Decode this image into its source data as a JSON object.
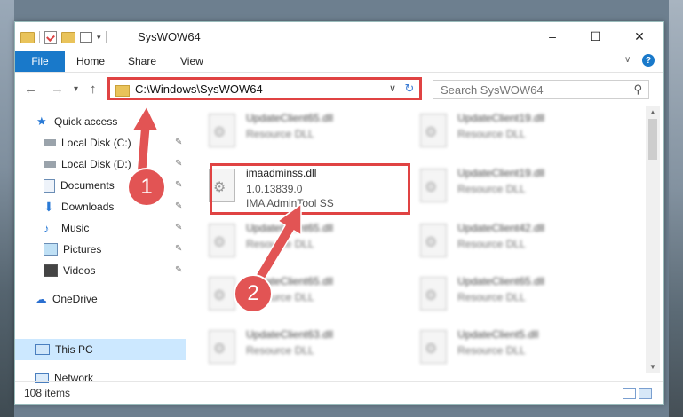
{
  "window": {
    "title": "SysWOW64",
    "controls": [
      "–",
      "☐",
      "✕"
    ]
  },
  "ribbon": {
    "tabs": [
      "File",
      "Home",
      "Share",
      "View"
    ],
    "help": "?"
  },
  "address": {
    "path": "C:\\Windows\\SysWOW64",
    "search_placeholder": "Search SysWOW64"
  },
  "sidebar": {
    "items": [
      {
        "label": "Quick access",
        "icon": "star-icon",
        "pinned": false
      },
      {
        "label": "Local Disk (C:)",
        "icon": "drive-icon",
        "pinned": true
      },
      {
        "label": "Local Disk (D:)",
        "icon": "drive-icon",
        "pinned": true
      },
      {
        "label": "Documents",
        "icon": "documents-icon",
        "pinned": true
      },
      {
        "label": "Downloads",
        "icon": "download-icon",
        "pinned": true
      },
      {
        "label": "Music",
        "icon": "music-icon",
        "pinned": true
      },
      {
        "label": "Pictures",
        "icon": "pictures-icon",
        "pinned": true
      },
      {
        "label": "Videos",
        "icon": "videos-icon",
        "pinned": true
      },
      {
        "label": "OneDrive",
        "icon": "cloud-icon",
        "pinned": false
      },
      {
        "label": "This PC",
        "icon": "computer-icon",
        "pinned": false,
        "selected": true
      },
      {
        "label": "Network",
        "icon": "network-icon",
        "pinned": false
      }
    ]
  },
  "files": {
    "highlighted": {
      "name": "imaadminss.dll",
      "version": "1.0.13839.0",
      "description": "IMA AdminTool SS"
    },
    "left_column": [
      {
        "name": "UpdateClient65.dll",
        "type": "Resource DLL"
      },
      {
        "name": "UpdateClient65.dll",
        "type": "Resource DLL"
      },
      {
        "name": "UpdateClient65.dll",
        "type": "Resource DLL"
      },
      {
        "name": "UpdateClient63.dll",
        "type": "Resource DLL"
      }
    ],
    "right_column": [
      {
        "name": "UpdateClient19.dll",
        "type": "Resource DLL"
      },
      {
        "name": "UpdateClient19.dll",
        "type": "Resource DLL"
      },
      {
        "name": "UpdateClient42.dll",
        "type": "Resource DLL"
      },
      {
        "name": "UpdateClient65.dll",
        "type": "Resource DLL"
      },
      {
        "name": "UpdateClient5.dll",
        "type": "Resource DLL"
      }
    ]
  },
  "status": {
    "item_count": "108 items"
  },
  "annotations": {
    "step1": "1",
    "step2": "2",
    "accent": "#e04343"
  }
}
